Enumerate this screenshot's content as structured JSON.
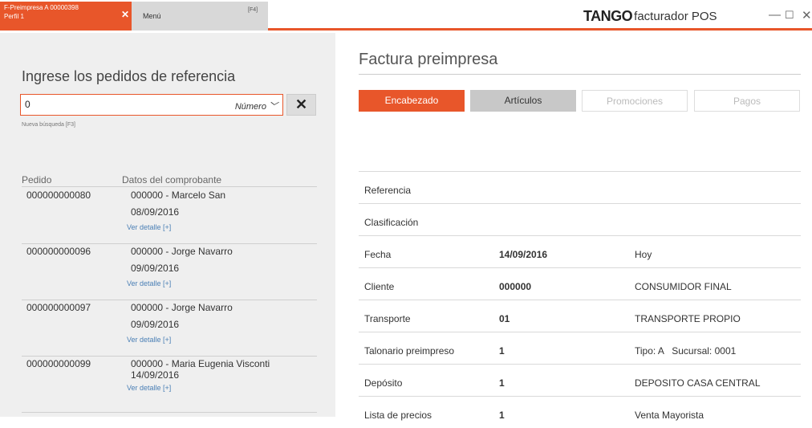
{
  "tabs": {
    "active": {
      "line1": "F-Preimpresa A 00000398",
      "line2": "Perfil 1"
    },
    "menu": {
      "label": "Menú",
      "shortcut": "[F4]"
    }
  },
  "brand": {
    "name": "TANGO",
    "product": "facturador POS"
  },
  "left": {
    "heading": "Ingrese los pedidos de referencia",
    "search": {
      "value": "0",
      "type": "Número"
    },
    "hint": "Nueva búsqueda [F3]",
    "columns": {
      "pedido": "Pedido",
      "datos": "Datos del comprobante"
    },
    "rows": [
      {
        "pedido": "000000000080",
        "cliente": "000000 - Marcelo San",
        "fecha": "08/09/2016",
        "link": "Ver detalle [+]"
      },
      {
        "pedido": "000000000096",
        "cliente": "000000 - Jorge Navarro",
        "fecha": "09/09/2016",
        "link": "Ver detalle [+]"
      },
      {
        "pedido": "000000000097",
        "cliente": "000000 - Jorge Navarro",
        "fecha": "09/09/2016",
        "link": "Ver detalle [+]"
      },
      {
        "pedido": "000000000099",
        "cliente": "000000 - Maria Eugenia Visconti",
        "fecha": "14/09/2016",
        "link": "Ver detalle [+]"
      }
    ]
  },
  "right": {
    "title": "Factura preimpresa",
    "nav": [
      "Encabezado",
      "Artículos",
      "Promociones",
      "Pagos"
    ],
    "fields": [
      {
        "label": "Referencia",
        "value": "",
        "extra": ""
      },
      {
        "label": "Clasificación",
        "value": "",
        "extra": ""
      },
      {
        "label": "Fecha",
        "value": "14/09/2016",
        "extra": "Hoy"
      },
      {
        "label": "Cliente",
        "value": "000000",
        "extra": "CONSUMIDOR FINAL"
      },
      {
        "label": "Transporte",
        "value": "01",
        "extra": "TRANSPORTE PROPIO"
      },
      {
        "label": "Talonario preimpreso",
        "value": "1",
        "extra": "Tipo: A   Sucursal: 0001"
      },
      {
        "label": "Depósito",
        "value": "1",
        "extra": "DEPOSITO CASA CENTRAL"
      },
      {
        "label": "Lista de precios",
        "value": "1",
        "extra": "Venta Mayorista"
      }
    ]
  },
  "colors": {
    "accent": "#e8562a",
    "link": "#4a7fb5",
    "panel": "#efefef"
  }
}
